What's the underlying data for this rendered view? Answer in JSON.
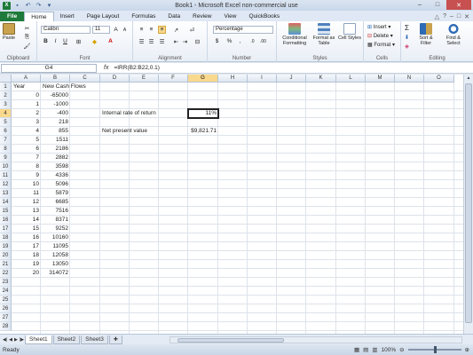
{
  "window": {
    "title": "Book1 - Microsoft Excel non-commercial use"
  },
  "ribbon_tabs": [
    "File",
    "Home",
    "Insert",
    "Page Layout",
    "Formulas",
    "Data",
    "Review",
    "View",
    "QuickBooks"
  ],
  "ribbon": {
    "clipboard": {
      "label": "Clipboard",
      "paste": "Paste"
    },
    "font": {
      "label": "Font",
      "name": "Calibri",
      "size": "11"
    },
    "alignment": {
      "label": "Alignment"
    },
    "number": {
      "label": "Number",
      "format": "Percentage"
    },
    "styles": {
      "label": "Styles",
      "conditional": "Conditional Formatting",
      "format_table": "Format as Table",
      "cell_styles": "Cell Styles"
    },
    "cells": {
      "label": "Cells",
      "insert": "Insert",
      "delete": "Delete",
      "format": "Format"
    },
    "editing": {
      "label": "Editing",
      "sort": "Sort & Filter",
      "find": "Find & Select"
    }
  },
  "formula_bar": {
    "name_box": "G4",
    "fx": "fx",
    "formula": "=IRR(B2:B22,0.1)"
  },
  "columns": [
    "A",
    "B",
    "C",
    "D",
    "E",
    "F",
    "G",
    "H",
    "I",
    "J",
    "K",
    "L",
    "M",
    "N",
    "O"
  ],
  "rows": [
    "1",
    "2",
    "3",
    "4",
    "5",
    "6",
    "7",
    "8",
    "9",
    "10",
    "11",
    "12",
    "13",
    "14",
    "15",
    "16",
    "17",
    "18",
    "19",
    "20",
    "21",
    "22",
    "23",
    "24",
    "25",
    "26",
    "27",
    "28"
  ],
  "sheet": {
    "A1": "Year",
    "B1": "New Cash Flows",
    "year_values": [
      "0",
      "1",
      "2",
      "3",
      "4",
      "5",
      "6",
      "7",
      "8",
      "9",
      "10",
      "11",
      "12",
      "13",
      "14",
      "15",
      "16",
      "17",
      "18",
      "19",
      "20"
    ],
    "cash_flows": [
      "-65000",
      "-1000",
      "-400",
      "218",
      "855",
      "1511",
      "2186",
      "2882",
      "3598",
      "4336",
      "5096",
      "5879",
      "6685",
      "7516",
      "8371",
      "9252",
      "10160",
      "11095",
      "12058",
      "13050",
      "314072"
    ],
    "D4": "Internal rate of return",
    "G4": "11%",
    "D6": "Net present value",
    "G6": "$9,821.71"
  },
  "sheet_tabs": [
    "Sheet1",
    "Sheet2",
    "Sheet3"
  ],
  "status": {
    "text": "Ready",
    "zoom": "100%"
  }
}
